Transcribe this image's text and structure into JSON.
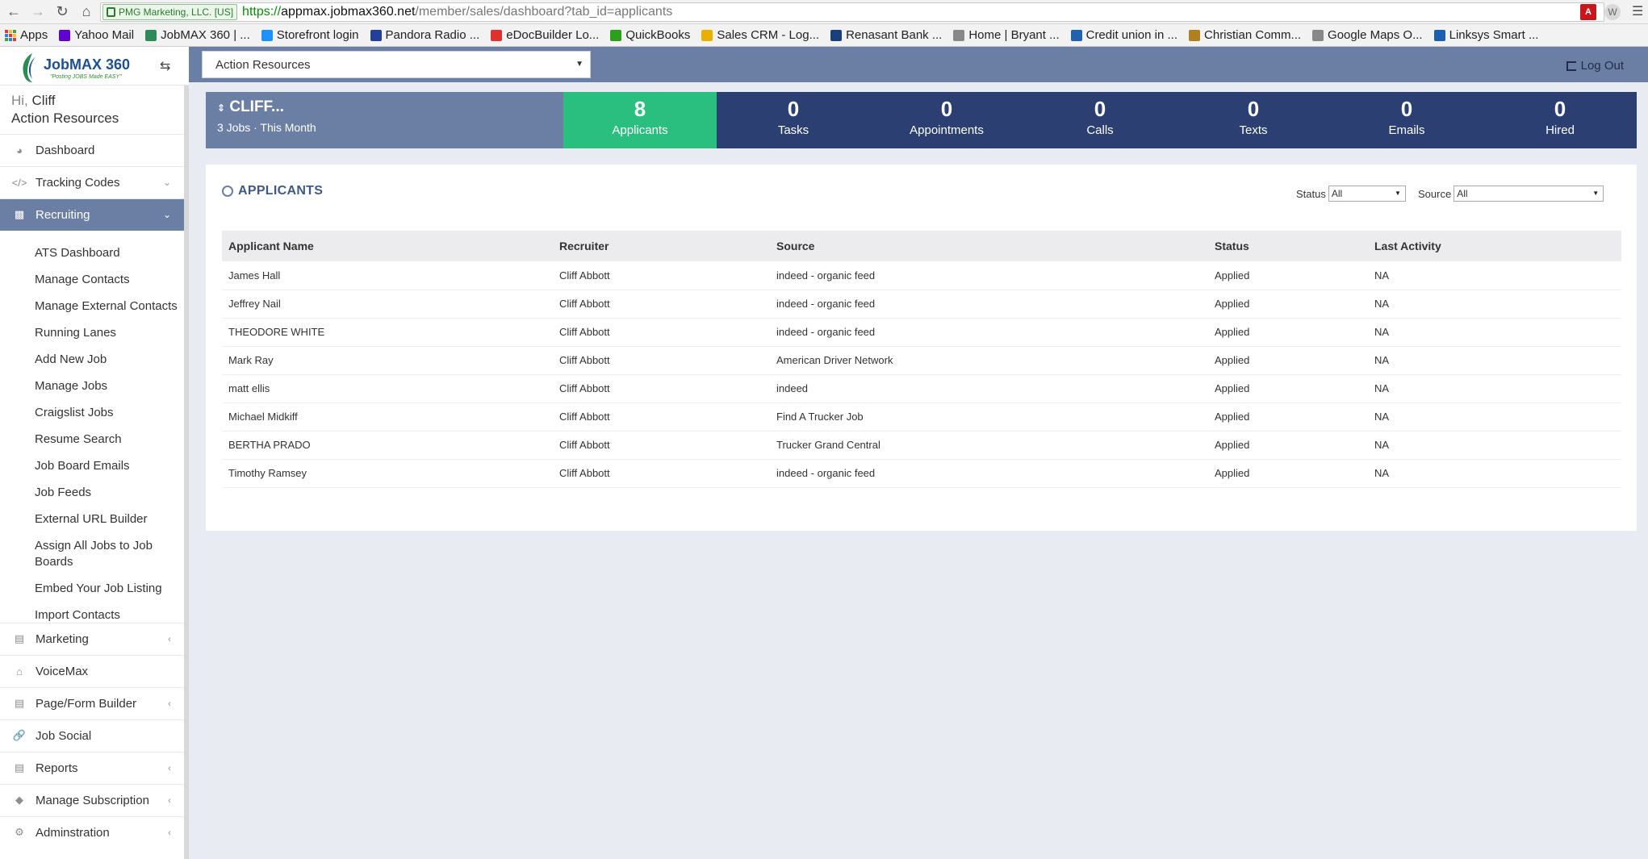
{
  "browser": {
    "cert_label": "PMG Marketing, LLC. [US]",
    "url_scheme": "https://",
    "url_host": "appmax.jobmax360.net",
    "url_path": "/member/sales/dashboard?tab_id=applicants",
    "bookmarks": [
      {
        "label": "Apps",
        "icon": "apps-grid-icon",
        "color": "#555"
      },
      {
        "label": "Yahoo Mail",
        "icon": "yahoo-icon",
        "color": "#5f01d1"
      },
      {
        "label": "JobMAX 360 | ...",
        "icon": "jobmax-icon",
        "color": "#2e8b57"
      },
      {
        "label": "Storefront login",
        "icon": "storefront-icon",
        "color": "#1e90ff"
      },
      {
        "label": "Pandora Radio ...",
        "icon": "pandora-icon",
        "color": "#224099"
      },
      {
        "label": "eDocBuilder Lo...",
        "icon": "edoc-icon",
        "color": "#e03030"
      },
      {
        "label": "QuickBooks",
        "icon": "quickbooks-icon",
        "color": "#2ca01c"
      },
      {
        "label": "Sales CRM - Log...",
        "icon": "crm-icon",
        "color": "#e8b100"
      },
      {
        "label": "Renasant Bank ...",
        "icon": "renasant-icon",
        "color": "#1a3f7a"
      },
      {
        "label": "Home | Bryant ...",
        "icon": "page-icon",
        "color": "#888"
      },
      {
        "label": "Credit union in ...",
        "icon": "credit-union-icon",
        "color": "#2060b0"
      },
      {
        "label": "Christian Comm...",
        "icon": "christian-icon",
        "color": "#b08020"
      },
      {
        "label": "Google Maps O...",
        "icon": "page-icon",
        "color": "#888"
      },
      {
        "label": "Linksys Smart ...",
        "icon": "linksys-icon",
        "color": "#1a5fb4"
      }
    ]
  },
  "app": {
    "logo_text": "JobMAX 360",
    "logo_tagline": "\"Posting JOBS Made EASY\"",
    "company_select": "Action Resources",
    "logout_label": "Log Out"
  },
  "sidebar": {
    "greeting_hi": "Hi,",
    "user_name": "Cliff",
    "company": "Action Resources",
    "items": [
      {
        "label": "Dashboard",
        "icon": "dashboard-icon"
      },
      {
        "label": "Tracking Codes",
        "icon": "code-icon"
      },
      {
        "label": "Recruiting",
        "icon": "bar-chart-icon"
      },
      {
        "label": "Marketing",
        "icon": "newspaper-icon"
      },
      {
        "label": "VoiceMax",
        "icon": "home-icon"
      },
      {
        "label": "Page/Form Builder",
        "icon": "document-icon"
      },
      {
        "label": "Job Social",
        "icon": "link-icon"
      },
      {
        "label": "Reports",
        "icon": "document-icon"
      },
      {
        "label": "Manage Subscription",
        "icon": "tag-icon"
      },
      {
        "label": "Adminstration",
        "icon": "gears-icon"
      }
    ],
    "recruiting_sub": [
      "ATS Dashboard",
      "Manage Contacts",
      "Manage External Contacts",
      "Running Lanes",
      "Add New Job",
      "Manage Jobs",
      "Craigslist Jobs",
      "Resume Search",
      "Job Board Emails",
      "Job Feeds",
      "External URL Builder",
      "Assign All Jobs to Job Boards",
      "Embed Your Job Listing",
      "Import Contacts"
    ]
  },
  "stats": {
    "name": "CLIFF...",
    "period": "3 Jobs · This Month",
    "items": [
      {
        "value": "8",
        "label": "Applicants"
      },
      {
        "value": "0",
        "label": "Tasks"
      },
      {
        "value": "0",
        "label": "Appointments"
      },
      {
        "value": "0",
        "label": "Calls"
      },
      {
        "value": "0",
        "label": "Texts"
      },
      {
        "value": "0",
        "label": "Emails"
      },
      {
        "value": "0",
        "label": "Hired"
      }
    ]
  },
  "panel": {
    "title": "APPLICANTS",
    "status_label": "Status",
    "status_value": "All",
    "source_label": "Source",
    "source_value": "All",
    "columns": [
      "Applicant Name",
      "Recruiter",
      "Source",
      "Status",
      "Last Activity"
    ],
    "rows": [
      [
        "James Hall",
        "Cliff Abbott",
        "indeed - organic feed",
        "Applied",
        "NA"
      ],
      [
        "Jeffrey Nail",
        "Cliff Abbott",
        "indeed - organic feed",
        "Applied",
        "NA"
      ],
      [
        "THEODORE WHITE",
        "Cliff Abbott",
        "indeed - organic feed",
        "Applied",
        "NA"
      ],
      [
        "Mark Ray",
        "Cliff Abbott",
        "American Driver Network",
        "Applied",
        "NA"
      ],
      [
        "matt ellis",
        "Cliff Abbott",
        "indeed",
        "Applied",
        "NA"
      ],
      [
        "Michael Midkiff",
        "Cliff Abbott",
        "Find A Trucker Job",
        "Applied",
        "NA"
      ],
      [
        "BERTHA PRADO",
        "Cliff Abbott",
        "Trucker Grand Central",
        "Applied",
        "NA"
      ],
      [
        "Timothy Ramsey",
        "Cliff Abbott",
        "indeed - organic feed",
        "Applied",
        "NA"
      ]
    ]
  }
}
